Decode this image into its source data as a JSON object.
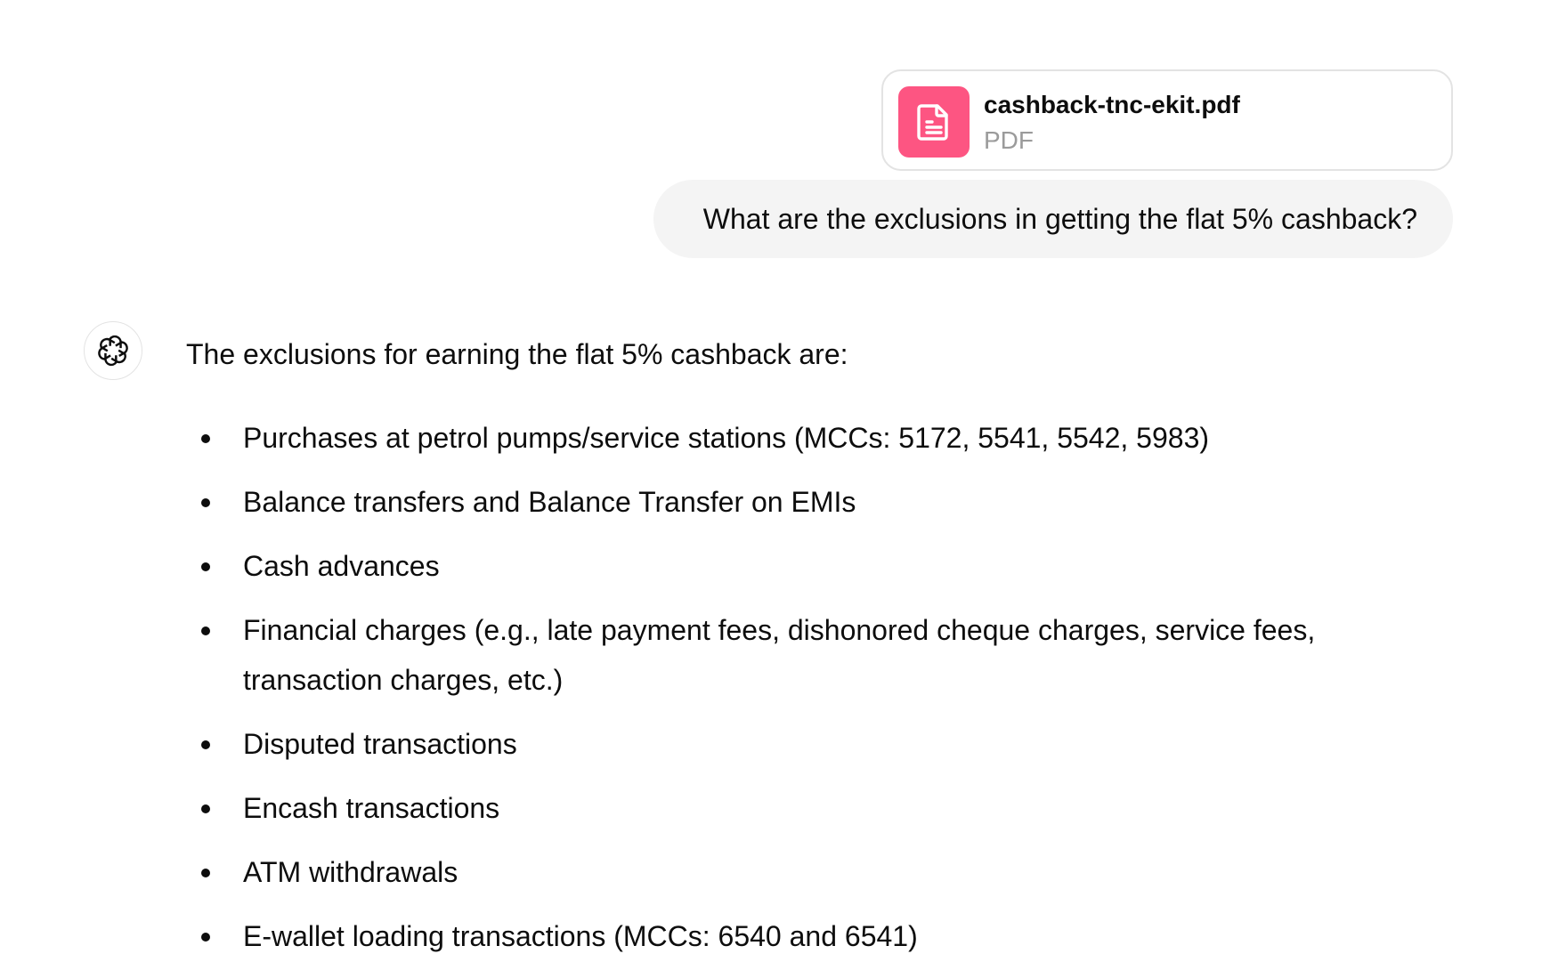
{
  "attachment": {
    "icon": "document-icon",
    "icon_color": "#fd5582",
    "file_name": "cashback-tnc-ekit.pdf",
    "file_type": "PDF"
  },
  "user_message": {
    "text": "What are the exclusions in getting the flat 5% cashback?"
  },
  "assistant": {
    "avatar_icon": "openai-logo-icon",
    "intro": "The exclusions for earning the flat 5% cashback are:",
    "exclusions": [
      "Purchases at petrol pumps/service stations (MCCs: 5172, 5541, 5542, 5983)",
      "Balance transfers and Balance Transfer on EMIs",
      "Cash advances",
      "Financial charges (e.g., late payment fees, dishonored cheque charges, service fees, transaction charges, etc.)",
      "Disputed transactions",
      "Encash transactions",
      "ATM withdrawals",
      "E-wallet loading transactions (MCCs: 6540 and 6541)"
    ]
  }
}
